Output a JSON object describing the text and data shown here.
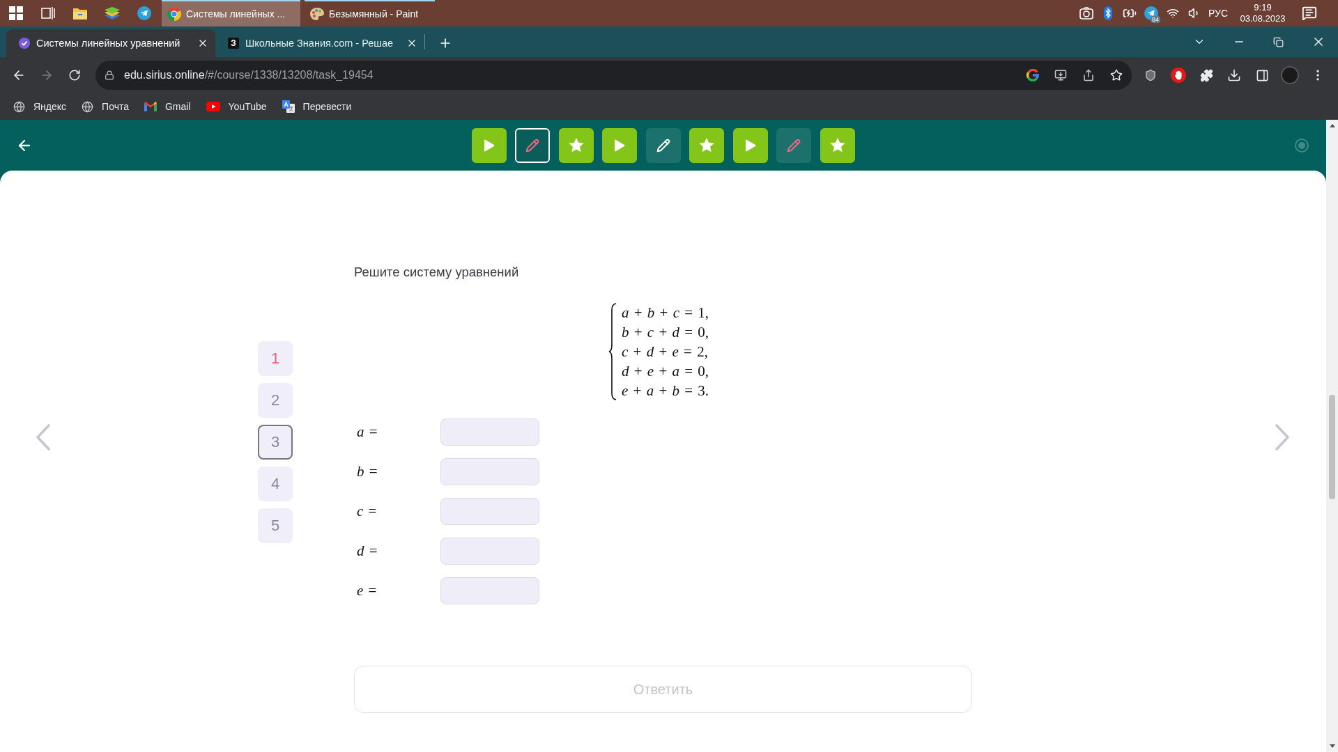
{
  "taskbar": {
    "windows": [
      {
        "title": "Системы линейных ...",
        "selected": true,
        "kind": "chrome"
      },
      {
        "title": "Безымянный - Paint",
        "selected": false,
        "kind": "paint"
      }
    ],
    "tray": {
      "badge": "84",
      "language": "РУС",
      "time": "9:19",
      "date": "03.08.2023"
    }
  },
  "browser": {
    "tabs": [
      {
        "title": "Системы линейных уравнений",
        "selected": true,
        "kind": "check"
      },
      {
        "title": "Школьные Знания.com - Решае",
        "selected": false,
        "kind": "letter",
        "letter": "З"
      }
    ],
    "address": {
      "host": "edu.sirius.online",
      "path": "/#/course/1338/13208/task_19454"
    },
    "bookmarks": [
      {
        "label": "Яндекс",
        "kind": "globe"
      },
      {
        "label": "Почта",
        "kind": "globe"
      },
      {
        "label": "Gmail",
        "kind": "gmail"
      },
      {
        "label": "YouTube",
        "kind": "youtube"
      },
      {
        "label": "Перевести",
        "kind": "translate"
      }
    ]
  },
  "tasks": [
    {
      "kind": "play",
      "done": true,
      "wrong": false,
      "selected": false
    },
    {
      "kind": "pencil",
      "done": false,
      "wrong": true,
      "selected": true
    },
    {
      "kind": "star",
      "done": true,
      "wrong": false,
      "selected": false
    },
    {
      "kind": "play",
      "done": true,
      "wrong": false,
      "selected": false
    },
    {
      "kind": "pencil",
      "done": false,
      "wrong": false,
      "selected": false
    },
    {
      "kind": "star",
      "done": true,
      "wrong": false,
      "selected": false
    },
    {
      "kind": "play",
      "done": true,
      "wrong": false,
      "selected": false
    },
    {
      "kind": "pencil",
      "done": false,
      "wrong": true,
      "selected": false
    },
    {
      "kind": "star",
      "done": true,
      "wrong": false,
      "selected": false
    }
  ],
  "task_list": [
    {
      "label": "1",
      "wrong": true,
      "selected": false
    },
    {
      "label": "2",
      "wrong": false,
      "selected": false
    },
    {
      "label": "3",
      "wrong": false,
      "selected": true
    },
    {
      "label": "4",
      "wrong": false,
      "selected": false
    },
    {
      "label": "5",
      "wrong": false,
      "selected": false
    }
  ],
  "problem": {
    "prompt": "Решите систему уравнений",
    "equations": [
      "*a* + *b* + *c* = 1,",
      "*b* + *c* + *d* = 0,",
      "*c* + *d* + *e* = 2,",
      "*d* + *e* + *a* = 0,",
      "*e* + *a* + *b* = 3."
    ],
    "answers": [
      {
        "label": "*a* ="
      },
      {
        "label": "*b* ="
      },
      {
        "label": "*c* ="
      },
      {
        "label": "*d* ="
      },
      {
        "label": "*e* ="
      }
    ]
  },
  "submit": {
    "label": "Ответить",
    "disabled": true
  }
}
